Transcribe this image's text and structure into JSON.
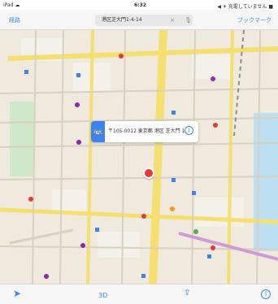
{
  "status": {
    "left": "iPad ☁",
    "time": "6:32",
    "right": "◀ ✈ 充電していません ■"
  },
  "header": {
    "left_label": "経路",
    "search_text": "港区芝大門1-4-14",
    "right_label": "ブックマーク"
  },
  "callout": {
    "text": "〒105-0012 東京都 港区 芝大門 1..."
  },
  "toolbar": {
    "three_d_label": "3D"
  },
  "colors": {
    "accent": "#3a86ff",
    "map_background": "#efeadd",
    "road_major": "#f4df6f",
    "park": "#cfe8c9",
    "water": "#bcdff2",
    "pin": "#e53935",
    "callout_bus": "#3b82f6"
  },
  "icons": {
    "locate": "location-arrow-icon",
    "share": "share-icon",
    "info": "info-icon",
    "bus": "bus-icon"
  }
}
